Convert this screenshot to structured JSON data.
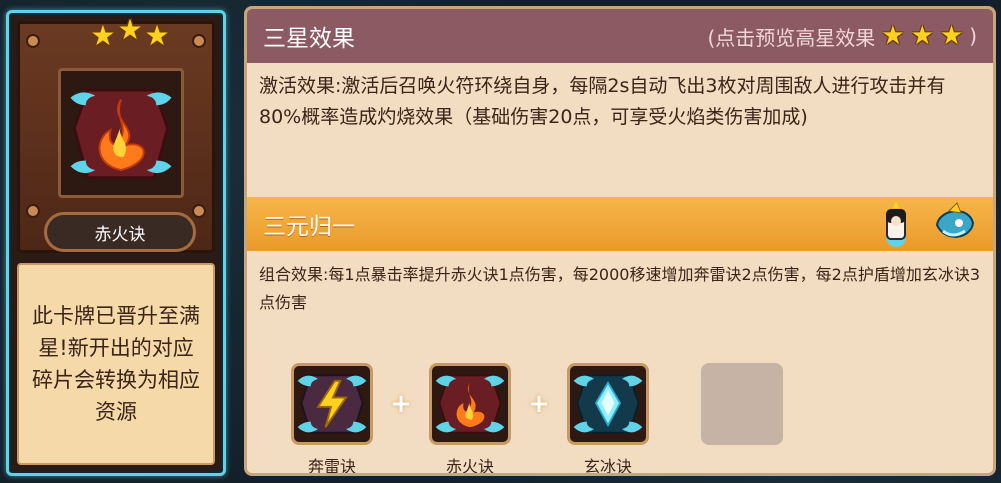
{
  "card": {
    "star_count": 3,
    "name": "赤火诀",
    "description": "此卡牌已晋升至满星!新开出的对应碎片会转换为相应资源"
  },
  "effect_panel": {
    "title": "三星效果",
    "preview_label": "(点击预览高星效果",
    "preview_close": ")",
    "preview_star_count": 3,
    "activate_text": "激活效果:激活后召唤火符环绕自身，每隔2s自动飞出3枚对周围敌人进行攻击并有80%概率造成灼烧效果（基础伤害20点，可享受火焰类伤害加成)"
  },
  "combo": {
    "title": "三元归一",
    "effect_text": "组合效果:每1点暴击率提升赤火诀1点伤害，每2000移速增加奔雷诀2点伤害，每2点护盾增加玄冰诀3点伤害",
    "avatars": [
      "priestess-avatar-icon",
      "ice-dragon-avatar-icon"
    ],
    "items": [
      {
        "label": "奔雷诀",
        "icon": "lightning-talisman-icon"
      },
      {
        "label": "赤火诀",
        "icon": "fire-talisman-icon"
      },
      {
        "label": "玄冰诀",
        "icon": "ice-talisman-icon"
      }
    ],
    "plus": "+"
  },
  "colors": {
    "header_bg": "#8c5a63",
    "combo_bar": "#f2a838",
    "panel_bg": "#f2dcc2",
    "desc_bg": "#f5d9a8",
    "frame_glow": "#5fd3e8",
    "star": "#ffd21f"
  }
}
